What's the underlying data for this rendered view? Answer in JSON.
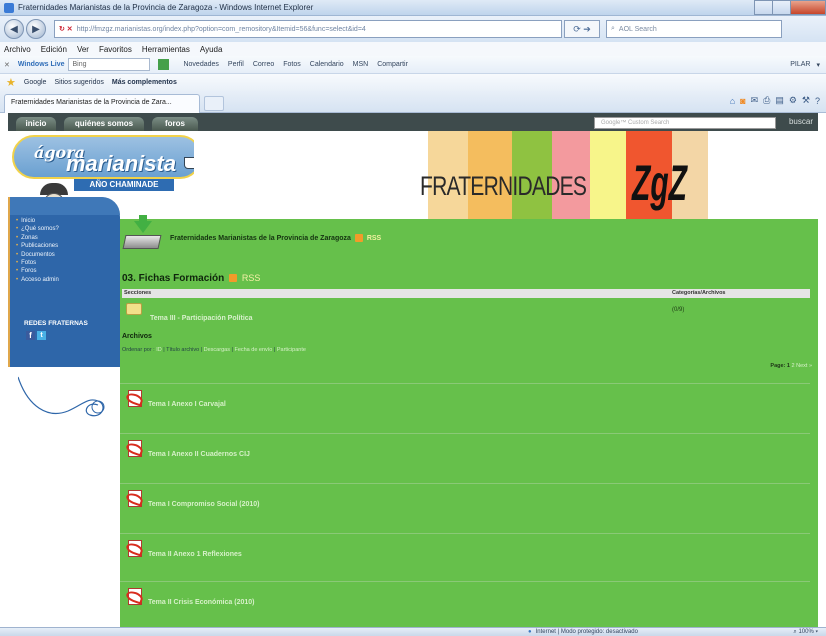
{
  "browser": {
    "window_title": "Fraternidades Marianistas de la Provincia de Zaragoza - Windows Internet Explorer",
    "url_host": "http://fmzgz.marianistas.org",
    "url_path": "/index.php?option=com_remository&Itemid=56&func=select&id=4",
    "search_placeholder": "AOL Search",
    "menu": [
      "Archivo",
      "Edición",
      "Ver",
      "Favoritos",
      "Herramientas",
      "Ayuda"
    ],
    "windows_live": {
      "brand": "Windows Live",
      "search_value": "Bing",
      "links": [
        "Novedades",
        "Perfil",
        "Correo",
        "Fotos",
        "Calendario",
        "MSN",
        "Compartir"
      ],
      "user": "PILAR"
    },
    "favorites": {
      "google": "Google",
      "suggested": "Sitios sugeridos",
      "more": "Más complementos"
    },
    "tab_title": "Fraternidades Marianistas de la Provincia de Zara...",
    "status": {
      "zone": "Internet | Modo protegido: desactivado",
      "zoom": "100%"
    }
  },
  "site": {
    "top_nav": [
      "inicio",
      "quiénes somos",
      "foros"
    ],
    "search_placeholder": "Google™ Custom Search",
    "search_button": "buscar",
    "logo": {
      "agora": "ágora",
      "marianista": "marianista",
      "band": "AÑO CHAMINADE"
    },
    "banner_title": "FRATERNIDADES",
    "banner_zgz": "ZgZ",
    "banner_colors": [
      "#f6d79a",
      "#f4bd5e",
      "#f6d28c",
      "#8fc241",
      "#f39a9e",
      "#f7f58a",
      "#f0562f",
      "#f3d6a6"
    ],
    "sidebar": {
      "menu": [
        "Inicio",
        "¿Qué somos?",
        "Zonas",
        "Publicaciones",
        "Documentos",
        "Fotos",
        "Foros",
        "Acceso admin"
      ],
      "redes_label": "REDES FRATERNAS",
      "facebook_icon": "f",
      "twitter_icon": "t"
    },
    "content": {
      "site_title": "Fraternidades Marianistas de la Provincia de Zaragoza",
      "site_rss": "RSS",
      "heading": "03. Fichas Formación",
      "heading_rss": "RSS",
      "col_sections": "Secciones",
      "col_categories": "Categorías/Archivos",
      "folder_name": "Tema III - Participación Política",
      "folder_count": "(0/9)",
      "archivos_label": "Archivos",
      "order_label": "Ordenar por :",
      "order_options": [
        "ID",
        "Título archivo",
        "Descargas",
        "Fecha de envío",
        "Participante"
      ],
      "pager_label": "Page:",
      "pager_current": "1",
      "pager_next": "2 Next »",
      "files": [
        "Tema I Anexo I Carvajal",
        "Tema I Anexo II Cuadernos CIJ",
        "Tema I Compromiso Social (2010)",
        "Tema II Anexo 1 Reflexiones",
        "Tema II Crisis Económica (2010)"
      ]
    }
  }
}
